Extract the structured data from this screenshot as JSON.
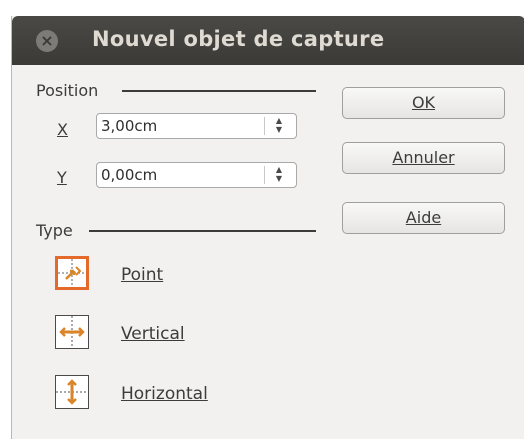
{
  "window": {
    "title": "Nouvel objet de capture",
    "close_icon": "×"
  },
  "position": {
    "header": "Position",
    "x": {
      "label": "X",
      "value": "3,00cm"
    },
    "y": {
      "label": "Y",
      "value": "0,00cm"
    },
    "spin_up": "▲",
    "spin_down": "▼"
  },
  "type": {
    "header": "Type",
    "options": [
      {
        "label": "Point",
        "selected": true,
        "icon": "snap-point-icon"
      },
      {
        "label": "Vertical",
        "selected": false,
        "icon": "snap-vertical-icon"
      },
      {
        "label": "Horizontal",
        "selected": false,
        "icon": "snap-horizontal-icon"
      }
    ]
  },
  "buttons": {
    "ok": "OK",
    "cancel": "Annuler",
    "help": "Aide"
  },
  "colors": {
    "accent": "#e46a2c",
    "titlebar": "#3c3b37",
    "dialog_bg": "#f2f1f0"
  }
}
